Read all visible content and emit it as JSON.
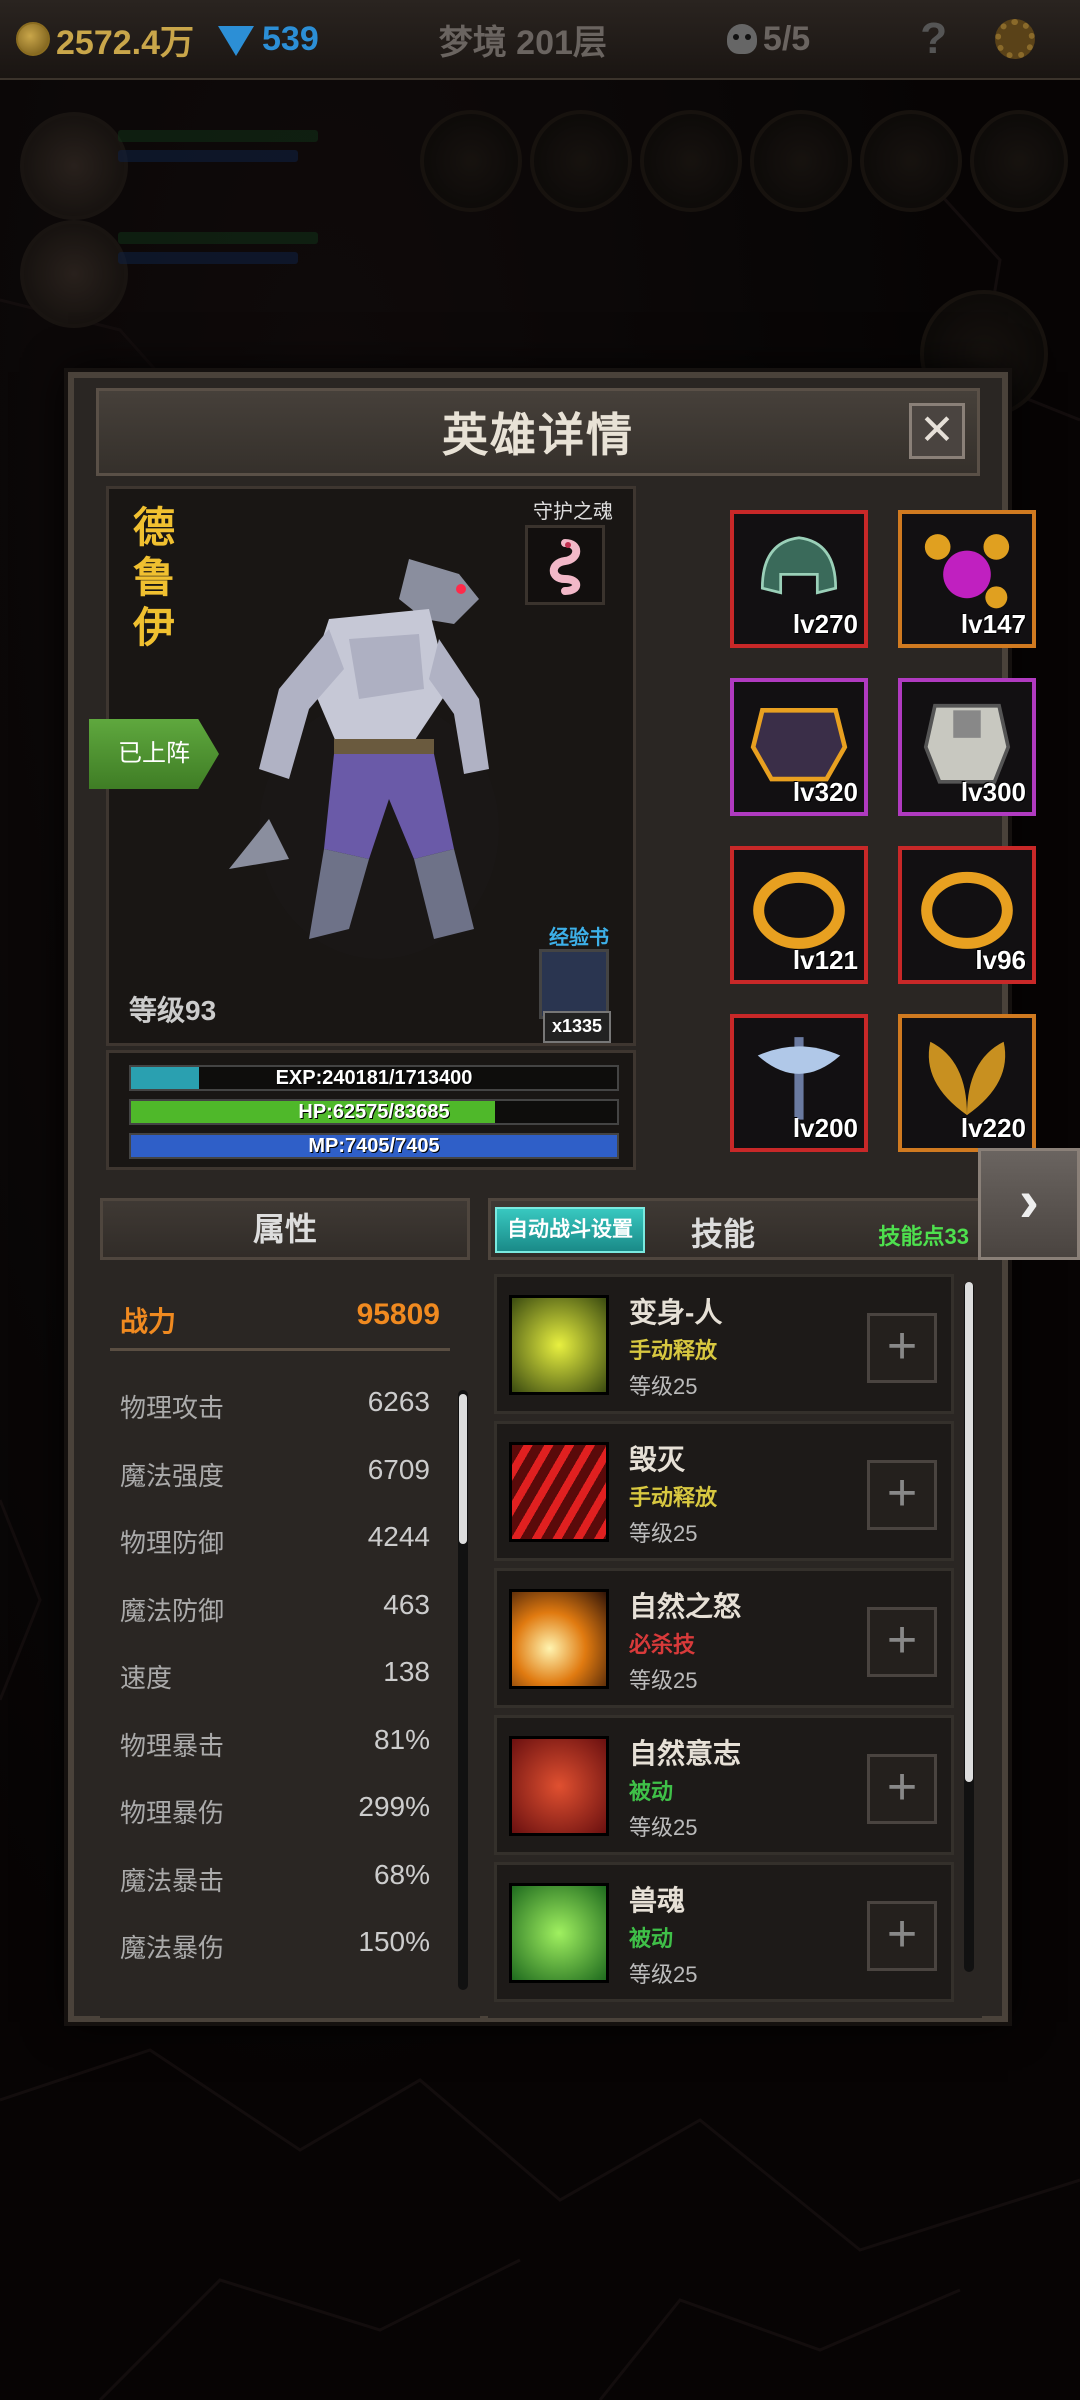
{
  "topbar": {
    "gold": "2572.4万",
    "gems": "539",
    "stage": "梦境 201层",
    "lives": "5/5",
    "help": "?"
  },
  "modal": {
    "title": "英雄详情",
    "close": "✕"
  },
  "hero": {
    "name_chars": [
      "德",
      "鲁",
      "伊"
    ],
    "deployed": "已上阵",
    "soul_label": "守护之魂",
    "exp_book_label": "经验书",
    "exp_book_count": "x1335",
    "level": "等级93",
    "exp": {
      "text": "EXP:240181/1713400",
      "fraction": 0.14
    },
    "hp": {
      "text": "HP:62575/83685",
      "fraction": 0.748
    },
    "mp": {
      "text": "MP:7405/7405",
      "fraction": 1.0
    }
  },
  "equipment": [
    {
      "level": "lv270",
      "border": "#c82828",
      "icon": "helmet-icon"
    },
    {
      "level": "lv147",
      "border": "#d07a20",
      "icon": "amulet-icon"
    },
    {
      "level": "lv320",
      "border": "#b03ac0",
      "icon": "chest-armor-icon"
    },
    {
      "level": "lv300",
      "border": "#b03ac0",
      "icon": "plate-armor-icon"
    },
    {
      "level": "lv121",
      "border": "#c82828",
      "icon": "ring-icon"
    },
    {
      "level": "lv96",
      "border": "#c82828",
      "icon": "ring-icon"
    },
    {
      "level": "lv200",
      "border": "#c82828",
      "icon": "axe-icon"
    },
    {
      "level": "lv220",
      "border": "#d07a20",
      "icon": "wing-icon"
    }
  ],
  "attributes": {
    "header": "属性",
    "power_label": "战力",
    "power_value": "95809",
    "rows": [
      {
        "k": "物理攻击",
        "v": "6263"
      },
      {
        "k": "魔法强度",
        "v": "6709"
      },
      {
        "k": "物理防御",
        "v": "4244"
      },
      {
        "k": "魔法防御",
        "v": "463"
      },
      {
        "k": "速度",
        "v": "138"
      },
      {
        "k": "物理暴击",
        "v": "81%"
      },
      {
        "k": "物理暴伤",
        "v": "299%"
      },
      {
        "k": "魔法暴击",
        "v": "68%"
      },
      {
        "k": "魔法暴伤",
        "v": "150%"
      }
    ]
  },
  "skills": {
    "auto_button": "自动战斗设置",
    "header": "技能",
    "points": "技能点33",
    "items": [
      {
        "name": "变身-人",
        "type": "手动释放",
        "type_color": "#d8c840",
        "level": "等级25"
      },
      {
        "name": "毁灭",
        "type": "手动释放",
        "type_color": "#d8c840",
        "level": "等级25"
      },
      {
        "name": "自然之怒",
        "type": "必杀技",
        "type_color": "#d83a3a",
        "level": "等级25"
      },
      {
        "name": "自然意志",
        "type": "被动",
        "type_color": "#3fc048",
        "level": "等级25"
      },
      {
        "name": "兽魂",
        "type": "被动",
        "type_color": "#3fc048",
        "level": "等级25"
      }
    ],
    "plus": "+"
  },
  "colors": {
    "gold": "#f0c030",
    "power": "#f08a20",
    "exp_fill": "#2aa0b0",
    "hp_fill": "#4fb82a",
    "mp_fill": "#2f5fc8"
  }
}
